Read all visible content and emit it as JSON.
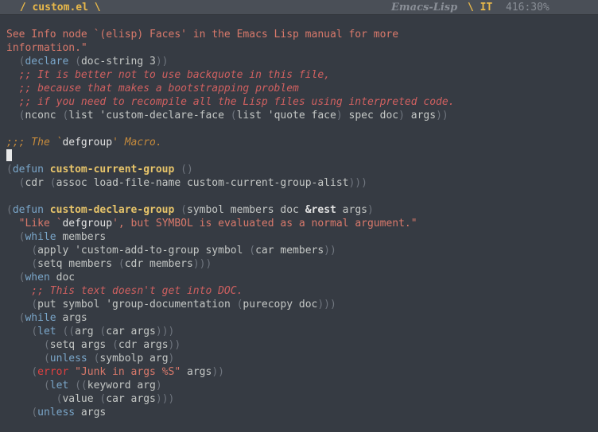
{
  "modeline": {
    "buffer": " / custom.el \\",
    "major_mode": "Emacs-Lisp",
    "state": "\\ IT",
    "position": "416:30%"
  },
  "editor": {
    "lines": [
      [
        {
          "c": "string",
          "t": "See Info node `(elisp) Faces' in the Emacs Lisp manual for more"
        }
      ],
      [
        {
          "c": "string",
          "t": "information.\""
        }
      ],
      [
        {
          "c": "default",
          "t": "  "
        },
        {
          "c": "paren",
          "t": "("
        },
        {
          "c": "keyword",
          "t": "declare"
        },
        {
          "c": "default",
          "t": " "
        },
        {
          "c": "paren",
          "t": "("
        },
        {
          "c": "default",
          "t": "doc-string 3"
        },
        {
          "c": "paren",
          "t": "))"
        }
      ],
      [
        {
          "c": "comment",
          "t": "  ;; It is better not to use backquote in this file,"
        }
      ],
      [
        {
          "c": "comment",
          "t": "  ;; because that makes a bootstrapping problem"
        }
      ],
      [
        {
          "c": "comment",
          "t": "  ;; if you need to recompile all the Lisp files using interpreted code."
        }
      ],
      [
        {
          "c": "default",
          "t": "  "
        },
        {
          "c": "paren",
          "t": "("
        },
        {
          "c": "default",
          "t": "nconc "
        },
        {
          "c": "paren",
          "t": "("
        },
        {
          "c": "default",
          "t": "list 'custom-declare-face "
        },
        {
          "c": "paren",
          "t": "("
        },
        {
          "c": "default",
          "t": "list 'quote face"
        },
        {
          "c": "paren",
          "t": ")"
        },
        {
          "c": "default",
          "t": " spec doc"
        },
        {
          "c": "paren",
          "t": ")"
        },
        {
          "c": "default",
          "t": " args"
        },
        {
          "c": "paren",
          "t": "))"
        }
      ],
      [],
      [
        {
          "c": "comment-head",
          "t": ";;; The `"
        },
        {
          "c": "docref",
          "t": "defgroup"
        },
        {
          "c": "comment-head",
          "t": "' Macro."
        }
      ],
      [
        {
          "c": "cursor",
          "t": ""
        }
      ],
      [
        {
          "c": "paren",
          "t": "("
        },
        {
          "c": "keyword",
          "t": "defun"
        },
        {
          "c": "default",
          "t": " "
        },
        {
          "c": "funcname",
          "t": "custom-current-group"
        },
        {
          "c": "default",
          "t": " "
        },
        {
          "c": "paren",
          "t": "()"
        }
      ],
      [
        {
          "c": "default",
          "t": "  "
        },
        {
          "c": "paren",
          "t": "("
        },
        {
          "c": "default",
          "t": "cdr "
        },
        {
          "c": "paren",
          "t": "("
        },
        {
          "c": "default",
          "t": "assoc load-file-name custom-current-group-alist"
        },
        {
          "c": "paren",
          "t": ")))"
        }
      ],
      [],
      [
        {
          "c": "paren",
          "t": "("
        },
        {
          "c": "keyword",
          "t": "defun"
        },
        {
          "c": "default",
          "t": " "
        },
        {
          "c": "funcname",
          "t": "custom-declare-group"
        },
        {
          "c": "default",
          "t": " "
        },
        {
          "c": "paren",
          "t": "("
        },
        {
          "c": "default",
          "t": "symbol members doc "
        },
        {
          "c": "rest",
          "t": "&rest"
        },
        {
          "c": "default",
          "t": " args"
        },
        {
          "c": "paren",
          "t": ")"
        }
      ],
      [
        {
          "c": "string",
          "t": "  \"Like `"
        },
        {
          "c": "docref",
          "t": "defgroup"
        },
        {
          "c": "string",
          "t": "', but SYMBOL is evaluated as a normal argument.\""
        }
      ],
      [
        {
          "c": "default",
          "t": "  "
        },
        {
          "c": "paren",
          "t": "("
        },
        {
          "c": "keyword",
          "t": "while"
        },
        {
          "c": "default",
          "t": " members"
        }
      ],
      [
        {
          "c": "default",
          "t": "    "
        },
        {
          "c": "paren",
          "t": "("
        },
        {
          "c": "default",
          "t": "apply 'custom-add-to-group symbol "
        },
        {
          "c": "paren",
          "t": "("
        },
        {
          "c": "default",
          "t": "car members"
        },
        {
          "c": "paren",
          "t": "))"
        }
      ],
      [
        {
          "c": "default",
          "t": "    "
        },
        {
          "c": "paren",
          "t": "("
        },
        {
          "c": "default",
          "t": "setq members "
        },
        {
          "c": "paren",
          "t": "("
        },
        {
          "c": "default",
          "t": "cdr members"
        },
        {
          "c": "paren",
          "t": ")))"
        }
      ],
      [
        {
          "c": "default",
          "t": "  "
        },
        {
          "c": "paren",
          "t": "("
        },
        {
          "c": "keyword",
          "t": "when"
        },
        {
          "c": "default",
          "t": " doc"
        }
      ],
      [
        {
          "c": "comment",
          "t": "    ;; This text doesn't get into DOC."
        }
      ],
      [
        {
          "c": "default",
          "t": "    "
        },
        {
          "c": "paren",
          "t": "("
        },
        {
          "c": "default",
          "t": "put symbol 'group-documentation "
        },
        {
          "c": "paren",
          "t": "("
        },
        {
          "c": "default",
          "t": "purecopy doc"
        },
        {
          "c": "paren",
          "t": ")))"
        }
      ],
      [
        {
          "c": "default",
          "t": "  "
        },
        {
          "c": "paren",
          "t": "("
        },
        {
          "c": "keyword",
          "t": "while"
        },
        {
          "c": "default",
          "t": " args"
        }
      ],
      [
        {
          "c": "default",
          "t": "    "
        },
        {
          "c": "paren",
          "t": "("
        },
        {
          "c": "keyword",
          "t": "let"
        },
        {
          "c": "default",
          "t": " "
        },
        {
          "c": "paren",
          "t": "(("
        },
        {
          "c": "default",
          "t": "arg "
        },
        {
          "c": "paren",
          "t": "("
        },
        {
          "c": "default",
          "t": "car args"
        },
        {
          "c": "paren",
          "t": ")))"
        }
      ],
      [
        {
          "c": "default",
          "t": "      "
        },
        {
          "c": "paren",
          "t": "("
        },
        {
          "c": "default",
          "t": "setq args "
        },
        {
          "c": "paren",
          "t": "("
        },
        {
          "c": "default",
          "t": "cdr args"
        },
        {
          "c": "paren",
          "t": "))"
        }
      ],
      [
        {
          "c": "default",
          "t": "      "
        },
        {
          "c": "paren",
          "t": "("
        },
        {
          "c": "keyword",
          "t": "unless"
        },
        {
          "c": "default",
          "t": " "
        },
        {
          "c": "paren",
          "t": "("
        },
        {
          "c": "default",
          "t": "symbolp arg"
        },
        {
          "c": "paren",
          "t": ")"
        }
      ],
      [
        {
          "c": "default",
          "t": "    "
        },
        {
          "c": "paren",
          "t": "("
        },
        {
          "c": "error",
          "t": "error"
        },
        {
          "c": "default",
          "t": " "
        },
        {
          "c": "string",
          "t": "\"Junk in args %S\""
        },
        {
          "c": "default",
          "t": " args"
        },
        {
          "c": "paren",
          "t": "))"
        }
      ],
      [
        {
          "c": "default",
          "t": "      "
        },
        {
          "c": "paren",
          "t": "("
        },
        {
          "c": "keyword",
          "t": "let"
        },
        {
          "c": "default",
          "t": " "
        },
        {
          "c": "paren",
          "t": "(("
        },
        {
          "c": "default",
          "t": "keyword arg"
        },
        {
          "c": "paren",
          "t": ")"
        }
      ],
      [
        {
          "c": "default",
          "t": "        "
        },
        {
          "c": "paren",
          "t": "("
        },
        {
          "c": "default",
          "t": "value "
        },
        {
          "c": "paren",
          "t": "("
        },
        {
          "c": "default",
          "t": "car args"
        },
        {
          "c": "paren",
          "t": ")))"
        }
      ],
      [
        {
          "c": "default",
          "t": "    "
        },
        {
          "c": "paren",
          "t": "("
        },
        {
          "c": "keyword",
          "t": "unless"
        },
        {
          "c": "default",
          "t": " args"
        }
      ]
    ]
  }
}
